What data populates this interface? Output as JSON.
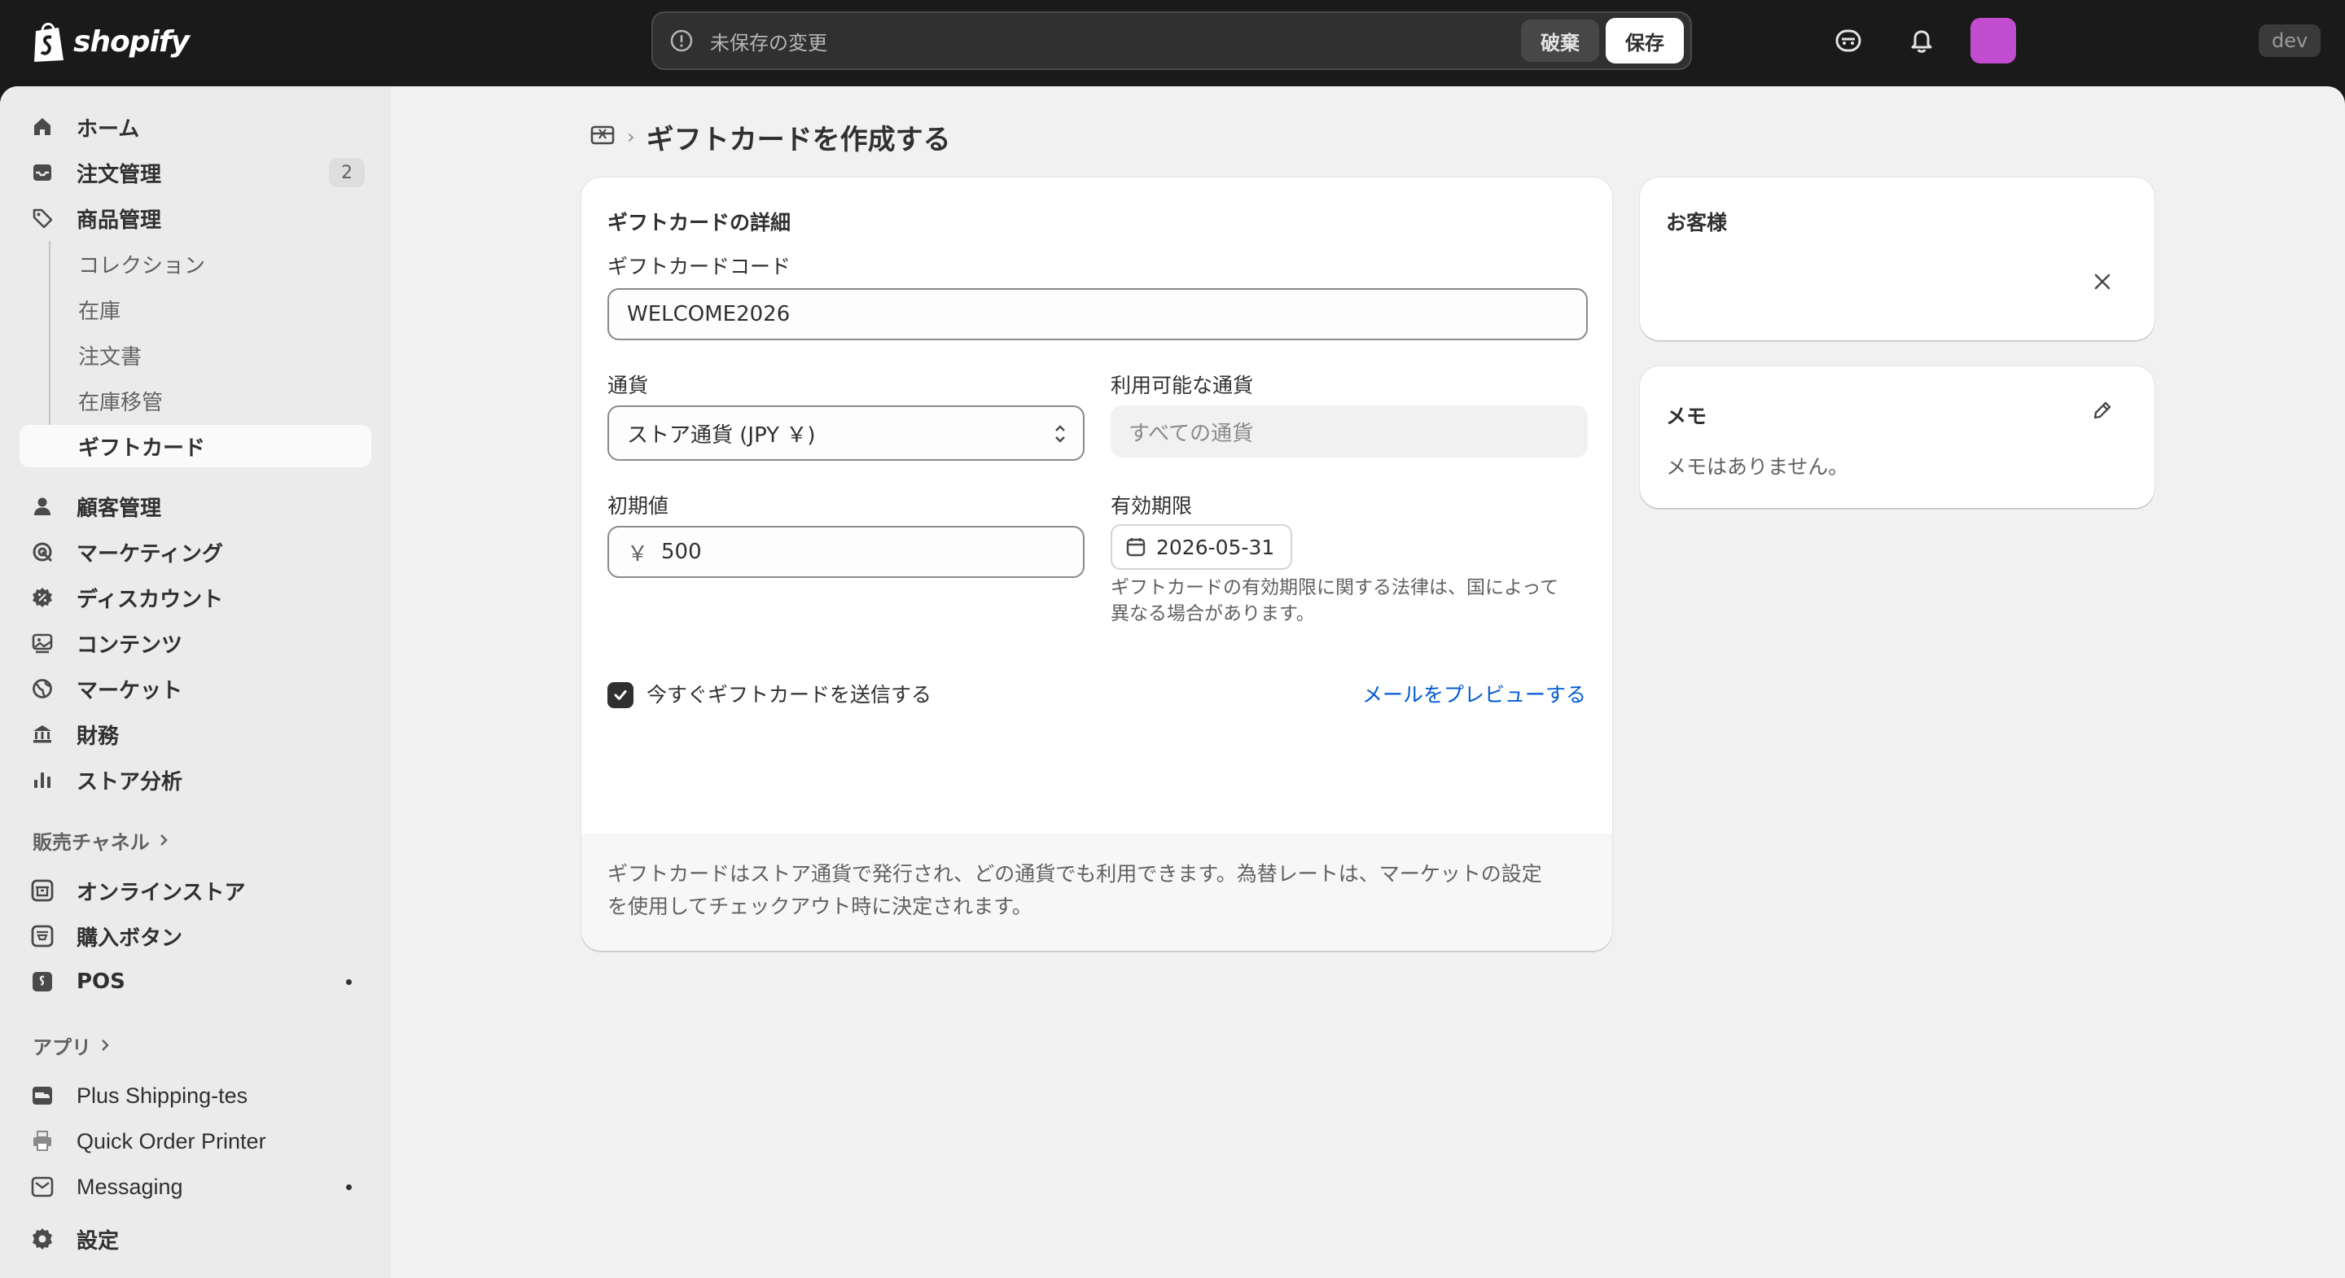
{
  "topbar": {
    "logo_text": "shopify",
    "unsaved_message": "未保存の変更",
    "discard_label": "破棄",
    "save_label": "保存",
    "dev_badge": "dev",
    "avatar_color": "#c24dd0"
  },
  "sidebar": {
    "items": [
      {
        "label": "ホーム",
        "icon": "home-icon"
      },
      {
        "label": "注文管理",
        "icon": "inbox-icon",
        "count": "2"
      },
      {
        "label": "商品管理",
        "icon": "tag-icon"
      },
      {
        "label": "コレクション"
      },
      {
        "label": "在庫"
      },
      {
        "label": "注文書"
      },
      {
        "label": "在庫移管"
      },
      {
        "label": "ギフトカード"
      },
      {
        "label": "顧客管理",
        "icon": "person-icon"
      },
      {
        "label": "マーケティング",
        "icon": "target-icon"
      },
      {
        "label": "ディスカウント",
        "icon": "discount-icon"
      },
      {
        "label": "コンテンツ",
        "icon": "content-icon"
      },
      {
        "label": "マーケット",
        "icon": "globe-icon"
      },
      {
        "label": "財務",
        "icon": "bank-icon"
      },
      {
        "label": "ストア分析",
        "icon": "chart-icon"
      }
    ],
    "sales_channels_header": "販売チャネル",
    "sales_channels": [
      {
        "label": "オンラインストア",
        "icon": "store-icon"
      },
      {
        "label": "購入ボタン",
        "icon": "buy-button-icon"
      },
      {
        "label": "POS",
        "icon": "pos-icon"
      }
    ],
    "apps_header": "アプリ",
    "apps": [
      {
        "label": "Plus Shipping-tes"
      },
      {
        "label": "Quick Order Printer"
      },
      {
        "label": "Messaging"
      }
    ],
    "settings_label": "設定"
  },
  "page": {
    "title": "ギフトカードを作成する"
  },
  "details_card": {
    "title": "ギフトカードの詳細",
    "code_label": "ギフトカードコード",
    "code_value": "WELCOME2026",
    "currency_label": "通貨",
    "currency_value": "ストア通貨 (JPY ￥)",
    "available_currency_label": "利用可能な通貨",
    "available_currency_value": "すべての通貨",
    "initial_value_label": "初期値",
    "currency_symbol": "￥",
    "initial_value": "500",
    "expiry_label": "有効期限",
    "expiry_date": "2026-05-31",
    "expiry_help_line1": "ギフトカードの有効期限に関する法律は、国によって",
    "expiry_help_line2": "異なる場合があります。",
    "send_now_label": "今すぐギフトカードを送信する",
    "preview_link": "メールをプレビューする",
    "footer_line1": "ギフトカードはストア通貨で発行され、どの通貨でも利用できます。為替レートは、マーケットの設定",
    "footer_line2": "を使用してチェックアウト時に決定されます。"
  },
  "customer_card": {
    "title": "お客様"
  },
  "memo_card": {
    "title": "メモ",
    "empty_text": "メモはありません。"
  }
}
